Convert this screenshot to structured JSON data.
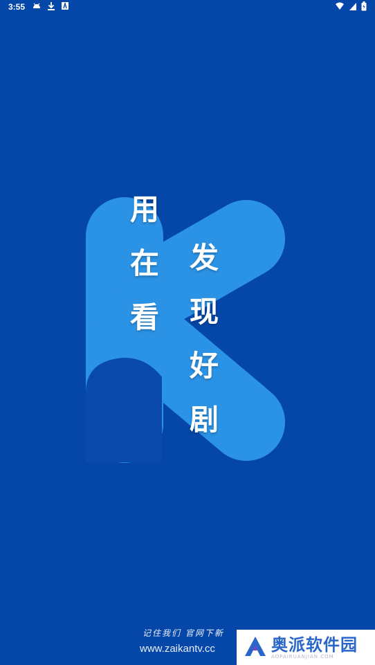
{
  "status_bar": {
    "time": "3:55",
    "left_icons": [
      "android-debug-icon",
      "download-icon",
      "app-notification-icon"
    ],
    "right_icons": [
      "wifi-icon",
      "cell-signal-icon",
      "battery-icon"
    ]
  },
  "splash": {
    "background_color": "#0447a8",
    "logo_color": "#2b93e6",
    "logo_letter": "K",
    "slogan_left": [
      "用",
      "在",
      "看"
    ],
    "slogan_right": [
      "发",
      "现",
      "好",
      "剧"
    ]
  },
  "footer": {
    "tagline": "记住我们 官网下新",
    "url": "www.zaikantv.cc"
  },
  "watermark": {
    "title": "奥派软件园",
    "subtitle": "AOPAIRUANJIAN.COM"
  }
}
